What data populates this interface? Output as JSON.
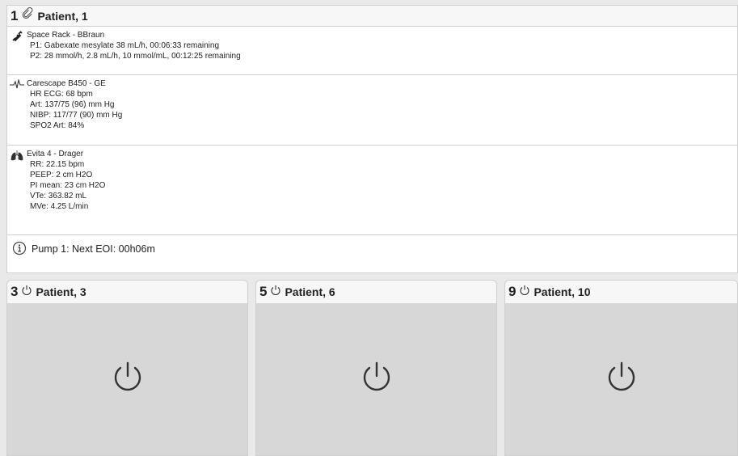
{
  "main": {
    "bed_number": "1",
    "status_icon": "link-icon",
    "patient": "Patient, 1",
    "devices": [
      {
        "icon": "syringe-icon",
        "title": "Space Rack - BBraun",
        "lines": [
          "P1: Gabexate mesylate 38 mL/h, 00:06:33 remaining",
          "P2: 28 mmol/h, 2.8 mL/h, 10 mmol/mL, 00:12:25 remaining"
        ]
      },
      {
        "icon": "ecg-waveform-icon",
        "title": "Carescape B450 - GE",
        "lines": [
          "HR ECG: 68 bpm",
          "Art: 137/75 (96) mm Hg",
          "NIBP: 117/77 (90) mm Hg",
          "SPO2 Art: 84%"
        ]
      },
      {
        "icon": "lungs-icon",
        "title": "Evita 4 - Drager",
        "lines": [
          "RR: 22.15 bpm",
          "PEEP:  2 cm H2O",
          "PI mean: 23 cm H2O",
          "VTe: 363.82 mL",
          "MVe: 4.25 L/min"
        ]
      }
    ],
    "alert": {
      "icon": "info-icon",
      "text": "Pump 1: Next EOI: 00h06m"
    }
  },
  "cards": [
    {
      "bed_number": "3",
      "patient": "Patient, 3",
      "status_icon": "power-icon"
    },
    {
      "bed_number": "5",
      "patient": "Patient, 6",
      "status_icon": "power-icon"
    },
    {
      "bed_number": "9",
      "patient": "Patient, 10",
      "status_icon": "power-icon"
    }
  ],
  "colors": {
    "panel_bg": "#e9e9e9",
    "card_body": "#d7d7d7",
    "header_bg": "#f7f7f7"
  }
}
